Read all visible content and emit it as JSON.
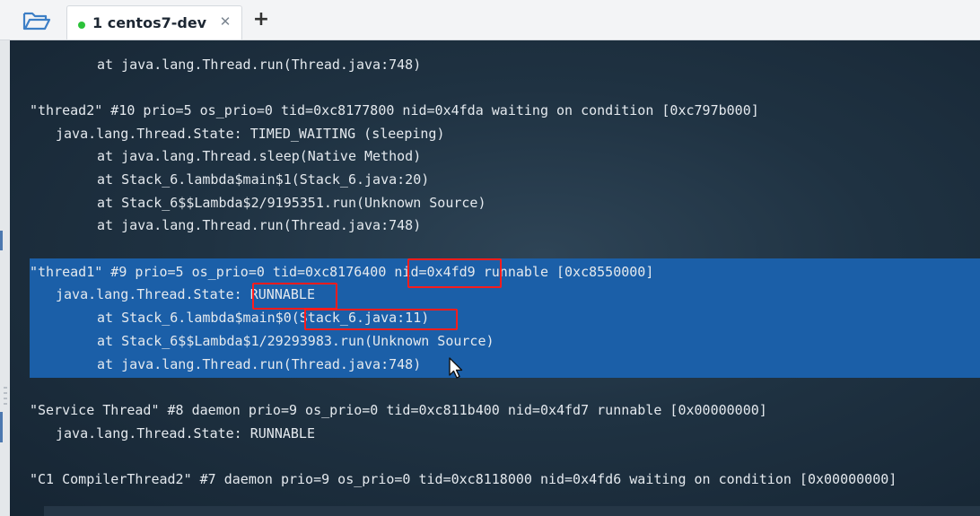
{
  "tabs": [
    {
      "label": "1 centos7-dev",
      "active": true,
      "status_color": "#2cc23a"
    }
  ],
  "icons": {
    "folder": "folder-open-icon",
    "close": "close-icon",
    "add": "plus-icon",
    "cursor": "mouse-pointer-icon"
  },
  "colors": {
    "terminal_bg": "#1f3242",
    "selection": "#1b5fa8",
    "highlight_box": "#ff1c1c",
    "text": "#e4e9ee"
  },
  "terminal": {
    "lines": [
      "at java.lang.Thread.run(Thread.java:748)",
      "",
      "\"thread2\" #10 prio=5 os_prio=0 tid=0xc8177800 nid=0x4fda waiting on condition [0xc797b000]",
      "java.lang.Thread.State: TIMED_WAITING (sleeping)",
      "at java.lang.Thread.sleep(Native Method)",
      "at Stack_6.lambda$main$1(Stack_6.java:20)",
      "at Stack_6$$Lambda$2/9195351.run(Unknown Source)",
      "at java.lang.Thread.run(Thread.java:748)",
      "",
      "\"thread1\" #9 prio=5 os_prio=0 tid=0xc8176400 nid=0x4fd9 runnable [0xc8550000]",
      "java.lang.Thread.State: RUNNABLE",
      "at Stack_6.lambda$main$0(Stack_6.java:11)",
      "at Stack_6$$Lambda$1/29293983.run(Unknown Source)",
      "at java.lang.Thread.run(Thread.java:748)",
      "",
      "\"Service Thread\" #8 daemon prio=9 os_prio=0 tid=0xc811b400 nid=0x4fd7 runnable [0x00000000]",
      "java.lang.Thread.State: RUNNABLE",
      "",
      "\"C1 CompilerThread2\" #7 daemon prio=9 os_prio=0 tid=0xc8118000 nid=0x4fd6 waiting on condition [0x00000000]"
    ],
    "highlights": [
      "nid=0x4fd9",
      "RUNNABLE",
      "Stack_6.java:11)"
    ]
  }
}
